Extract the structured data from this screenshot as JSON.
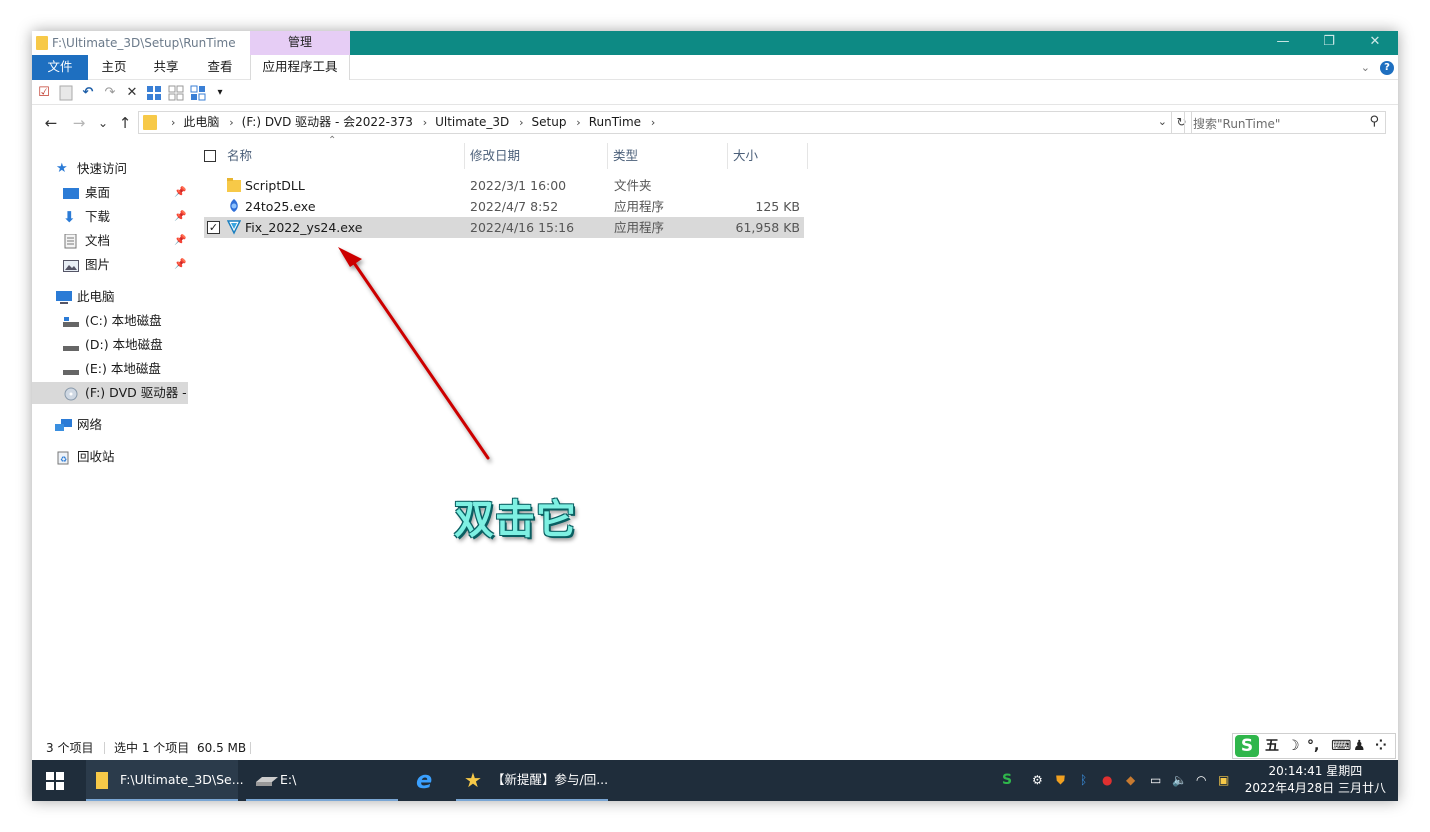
{
  "window": {
    "title": "F:\\Ultimate_3D\\Setup\\RunTime",
    "context_tab": "管理",
    "controls": {
      "minimize": "—",
      "maximize": "❐",
      "close": "✕"
    }
  },
  "ribbon": {
    "tabs": [
      "文件",
      "主页",
      "共享",
      "查看",
      "应用程序工具"
    ],
    "expand_icon": "chevron-down-icon",
    "help": "?"
  },
  "quick_access": {
    "icons": [
      "properties-icon",
      "new-folder-icon",
      "undo-icon",
      "redo-icon",
      "delete-icon",
      "view-details-icon",
      "view-tiles-icon",
      "view-list-icon",
      "customize-dropdown-icon"
    ]
  },
  "address": {
    "back": "←",
    "forward": "→",
    "recent": "⌄",
    "up": "↑",
    "crumbs": [
      "此电脑",
      "(F:) DVD 驱动器 - 会2022-373",
      "Ultimate_3D",
      "Setup",
      "RunTime"
    ],
    "search_placeholder": "搜索\"RunTime\""
  },
  "sidebar": {
    "quick_access_label": "快速访问",
    "pinned": [
      "桌面",
      "下载",
      "文档",
      "图片"
    ],
    "this_pc_label": "此电脑",
    "drives": [
      "(C:) 本地磁盘",
      "(D:) 本地磁盘",
      "(E:) 本地磁盘",
      "(F:) DVD 驱动器 - 会"
    ],
    "network_label": "网络",
    "recycle_label": "回收站"
  },
  "columns": {
    "name": "名称",
    "modified": "修改日期",
    "type": "类型",
    "size": "大小"
  },
  "files": [
    {
      "name": "ScriptDLL",
      "modified": "2022/3/1 16:00",
      "type": "文件夹",
      "size": "",
      "icon": "folder-icon"
    },
    {
      "name": "24to25.exe",
      "modified": "2022/4/7 8:52",
      "type": "应用程序",
      "size": "125 KB",
      "icon": "app-icon"
    },
    {
      "name": "Fix_2022_ys24.exe",
      "modified": "2022/4/16 15:16",
      "type": "应用程序",
      "size": "61,958 KB",
      "icon": "app-icon",
      "selected": true
    }
  ],
  "annotation": {
    "text": "双击它",
    "arrow_color": "#cc0000",
    "text_color": "#7ef0e2"
  },
  "status": {
    "item_count": "3 个项目",
    "selection": "选中 1 个项目",
    "selection_size": "60.5 MB"
  },
  "ime": {
    "logo": "S",
    "mode": "五",
    "moon": "☽",
    "punct": "°,",
    "keyboard": "⌨",
    "user": "♟",
    "menu": "⁘"
  },
  "taskbar": {
    "apps": [
      {
        "label": "F:\\Ultimate_3D\\Se...",
        "icon": "folder-icon"
      },
      {
        "label": "E:\\",
        "icon": "drive-icon"
      },
      {
        "label": "",
        "icon": "ie-icon"
      },
      {
        "label": "【新提醒】参与/回...",
        "icon": "star-icon"
      }
    ],
    "time": "20:14:41 星期四",
    "date": "2022年4月28日 三月廿八"
  },
  "colors": {
    "titlebar": "#0d8a84",
    "file_tab": "#1e6fc0",
    "manage_tab": "#e6cdf5",
    "selection": "#d9d9d9",
    "taskbar": "#1f2d3b"
  }
}
